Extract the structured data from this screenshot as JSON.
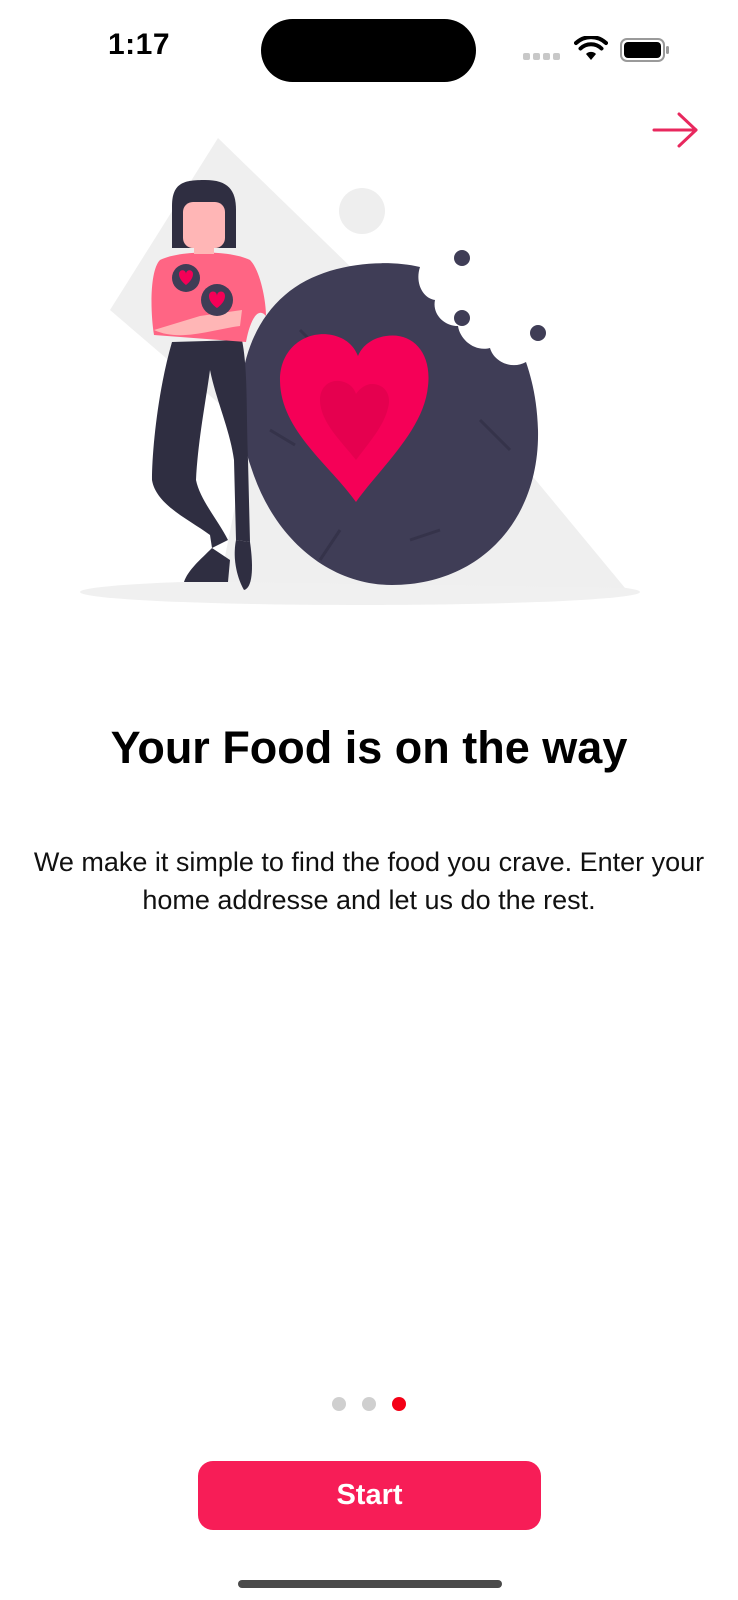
{
  "status_bar": {
    "time": "1:17"
  },
  "icons": {
    "skip": "arrow-right-icon",
    "wifi": "wifi-icon",
    "battery": "battery-icon",
    "signal": "cellular-signal-icon"
  },
  "colors": {
    "accent": "#f71d57",
    "active_dot": "#f40016",
    "inactive_dot": "#cfcfcf",
    "illustration_dark": "#3f3d56",
    "heart": "#f50057"
  },
  "onboarding": {
    "title": "Your Food is on the way",
    "description": "We make it simple to find the food you crave. Enter your  home addresse and let us do the rest.",
    "page_indicator": {
      "total": 3,
      "current": 3
    },
    "start_label": "Start"
  }
}
